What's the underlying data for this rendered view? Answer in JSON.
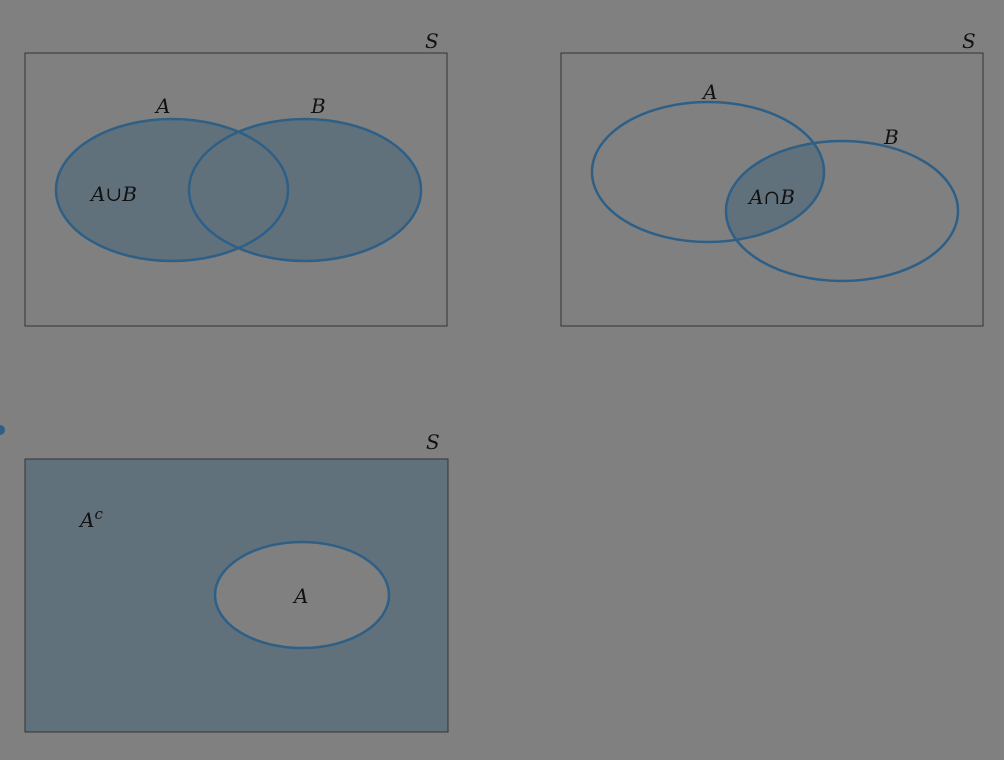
{
  "colors": {
    "background": "#808080",
    "shaded_region": "#61717c",
    "set_outline": "#2e5f86",
    "frame": "#333333",
    "text": "#111111"
  },
  "diagrams": [
    {
      "operation": "union",
      "universe_label": "S",
      "set_labels": [
        "A",
        "B"
      ],
      "region_label": "A∪B"
    },
    {
      "operation": "intersection",
      "universe_label": "S",
      "set_labels": [
        "A",
        "B"
      ],
      "region_label": "A∩B"
    },
    {
      "operation": "complement",
      "universe_label": "S",
      "set_labels": [
        "A"
      ],
      "region_label_base": "A",
      "region_label_sup": "c"
    }
  ]
}
